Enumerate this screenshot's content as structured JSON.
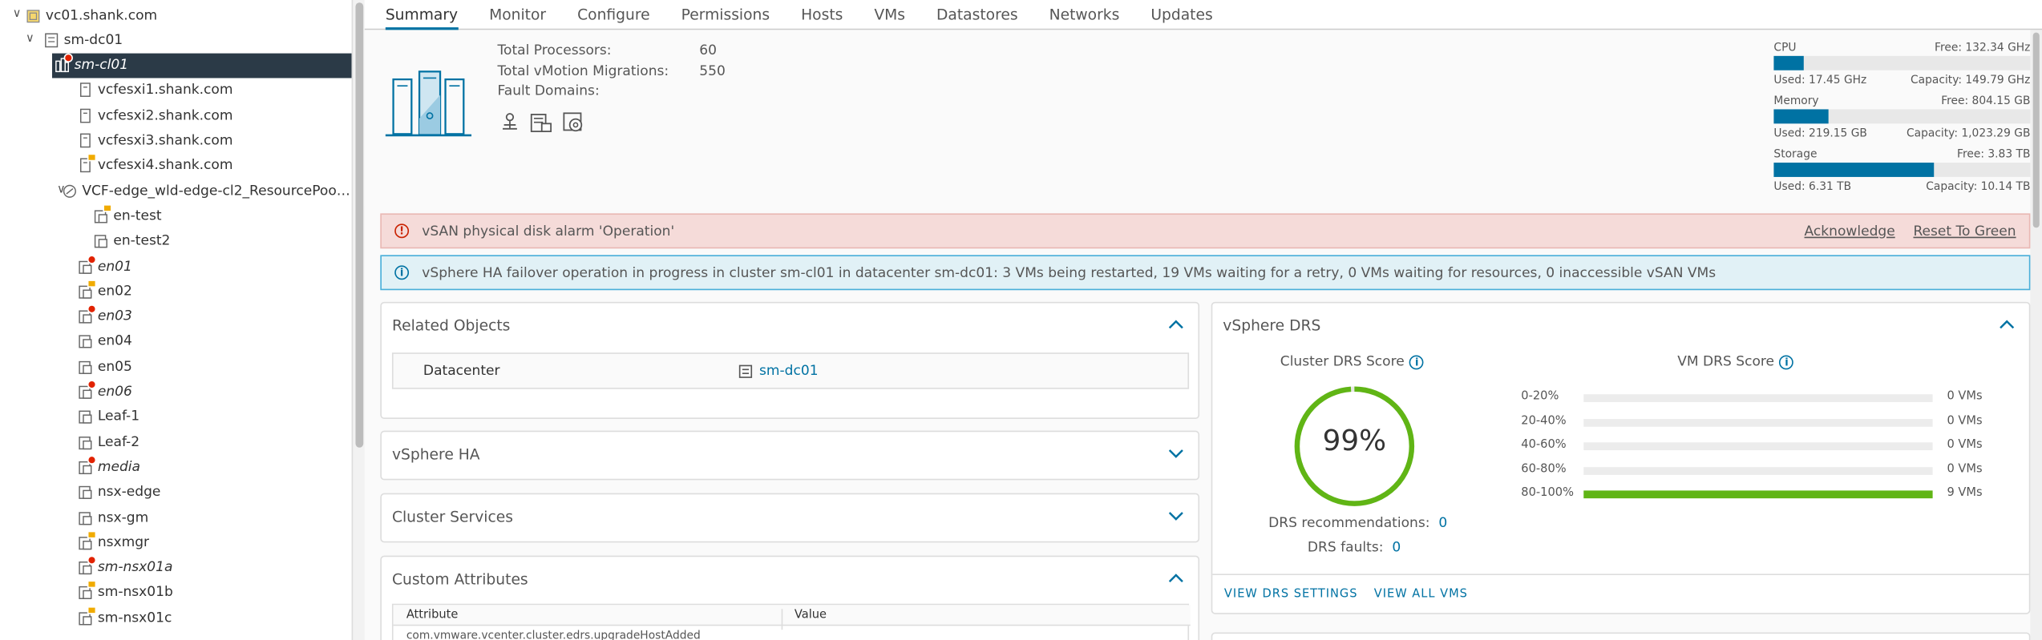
{
  "tree": {
    "items": [
      {
        "label": "vc01.shank.com",
        "italic": false,
        "icon": "vcenter-icon",
        "badge": ""
      },
      {
        "label": "sm-dc01",
        "italic": false,
        "icon": "datacenter-icon",
        "badge": ""
      },
      {
        "label": "sm-cl01",
        "italic": true,
        "icon": "cluster-icon",
        "badge": "error"
      },
      {
        "label": "vcfesxi1.shank.com",
        "italic": false,
        "icon": "host-icon",
        "badge": ""
      },
      {
        "label": "vcfesxi2.shank.com",
        "italic": false,
        "icon": "host-icon",
        "badge": ""
      },
      {
        "label": "vcfesxi3.shank.com",
        "italic": false,
        "icon": "host-icon",
        "badge": ""
      },
      {
        "label": "vcfesxi4.shank.com",
        "italic": false,
        "icon": "host-icon",
        "badge": "warning"
      },
      {
        "label": "VCF-edge_wld-edge-cl2_ResourcePool...",
        "italic": false,
        "icon": "resource-pool-icon",
        "badge": ""
      },
      {
        "label": "en-test",
        "italic": false,
        "icon": "vm-icon",
        "badge": "warning"
      },
      {
        "label": "en-test2",
        "italic": false,
        "icon": "vm-icon",
        "badge": ""
      },
      {
        "label": "en01",
        "italic": true,
        "icon": "vm-icon",
        "badge": "error"
      },
      {
        "label": "en02",
        "italic": false,
        "icon": "vm-icon",
        "badge": "warning"
      },
      {
        "label": "en03",
        "italic": true,
        "icon": "vm-icon",
        "badge": "error"
      },
      {
        "label": "en04",
        "italic": false,
        "icon": "vm-icon",
        "badge": ""
      },
      {
        "label": "en05",
        "italic": false,
        "icon": "vm-icon",
        "badge": ""
      },
      {
        "label": "en06",
        "italic": true,
        "icon": "vm-icon",
        "badge": "error"
      },
      {
        "label": "Leaf-1",
        "italic": false,
        "icon": "vm-icon",
        "badge": ""
      },
      {
        "label": "Leaf-2",
        "italic": false,
        "icon": "vm-icon",
        "badge": ""
      },
      {
        "label": "media",
        "italic": true,
        "icon": "vm-icon",
        "badge": "error"
      },
      {
        "label": "nsx-edge",
        "italic": false,
        "icon": "vm-icon",
        "badge": ""
      },
      {
        "label": "nsx-gm",
        "italic": false,
        "icon": "vm-icon",
        "badge": ""
      },
      {
        "label": "nsxmgr",
        "italic": false,
        "icon": "vm-icon",
        "badge": "warning"
      },
      {
        "label": "sm-nsx01a",
        "italic": true,
        "icon": "vm-icon",
        "badge": "error"
      },
      {
        "label": "sm-nsx01b",
        "italic": false,
        "icon": "vm-icon",
        "badge": "warning"
      },
      {
        "label": "sm-nsx01c",
        "italic": false,
        "icon": "vm-icon",
        "badge": "warning"
      }
    ]
  },
  "tabs": [
    "Summary",
    "Monitor",
    "Configure",
    "Permissions",
    "Hosts",
    "VMs",
    "Datastores",
    "Networks",
    "Updates"
  ],
  "summary": {
    "total_processors_label": "Total Processors:",
    "total_processors": "60",
    "vmotion_label": "Total vMotion Migrations:",
    "vmotion": "550",
    "fault_domains_label": "Fault Domains:"
  },
  "resources": [
    {
      "name": "CPU",
      "free": "Free: 132.34 GHz",
      "used": "Used: 17.45 GHz",
      "capacity": "Capacity: 149.79 GHz",
      "fraction": 0.117
    },
    {
      "name": "Memory",
      "free": "Free: 804.15 GB",
      "used": "Used: 219.15 GB",
      "capacity": "Capacity: 1,023.29 GB",
      "fraction": 0.214
    },
    {
      "name": "Storage",
      "free": "Free: 3.83 TB",
      "used": "Used: 6.31 TB",
      "capacity": "Capacity: 10.14 TB",
      "fraction": 0.622
    }
  ],
  "alerts": {
    "error_text": "vSAN physical disk alarm 'Operation'",
    "acknowledge": "Acknowledge",
    "reset": "Reset To Green",
    "info_text": "vSphere HA failover operation in progress in cluster sm-cl01 in datacenter sm-dc01: 3 VMs being restarted, 19 VMs waiting for a retry, 0 VMs waiting for resources, 0 inaccessible vSAN VMs"
  },
  "related": {
    "title": "Related Objects",
    "key": "Datacenter",
    "value": "sm-dc01"
  },
  "ha": {
    "title": "vSphere HA"
  },
  "services": {
    "title": "Cluster Services"
  },
  "custom": {
    "title": "Custom Attributes",
    "col_attribute": "Attribute",
    "col_value": "Value",
    "row_partial": "com.vmware.vcenter.cluster.edrs.upgradeHostAdded"
  },
  "drs": {
    "title": "vSphere DRS",
    "cluster_score_label": "Cluster DRS Score",
    "score": "99%",
    "score_fraction": 0.99,
    "vm_score_label": "VM DRS Score",
    "histogram": [
      {
        "range": "0-20%",
        "count": "0 VMs",
        "fraction": 0
      },
      {
        "range": "20-40%",
        "count": "0 VMs",
        "fraction": 0
      },
      {
        "range": "40-60%",
        "count": "0 VMs",
        "fraction": 0
      },
      {
        "range": "60-80%",
        "count": "0 VMs",
        "fraction": 0
      },
      {
        "range": "80-100%",
        "count": "9 VMs",
        "fraction": 1
      }
    ],
    "recommendations_label": "DRS recommendations:",
    "recommendations": "0",
    "faults_label": "DRS faults:",
    "faults": "0",
    "view_settings": "VIEW DRS SETTINGS",
    "view_vms": "VIEW ALL VMS"
  },
  "colors": {
    "accent": "#0072a3",
    "error": "#e12200",
    "warning": "#f0ab00",
    "success": "#60b515",
    "selected": "#2b3a47"
  }
}
